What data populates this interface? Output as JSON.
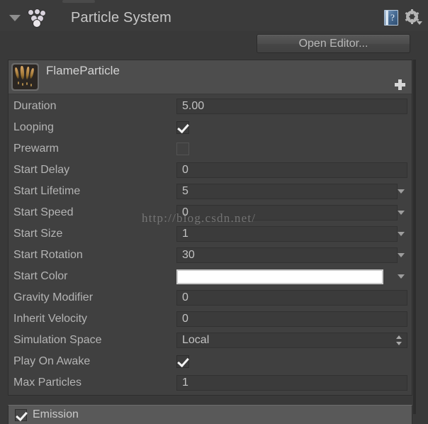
{
  "header": {
    "title": "Particle System",
    "foldout_icon": "triangle-down-icon",
    "component_icon": "particle-system-icon",
    "help_icon": "help-book-icon",
    "help_glyph": "?",
    "settings_icon": "gear-icon"
  },
  "toolbar": {
    "open_editor_label": "Open Editor..."
  },
  "emitter": {
    "name": "FlameParticle",
    "thumbnail_icon": "flame-particle-thumbnail",
    "add_icon": "plus-icon"
  },
  "properties": [
    {
      "label": "Duration",
      "type": "text",
      "value": "5.00",
      "dropdown": false
    },
    {
      "label": "Looping",
      "type": "checkbox",
      "checked": true
    },
    {
      "label": "Prewarm",
      "type": "checkbox",
      "checked": false
    },
    {
      "label": "Start Delay",
      "type": "text",
      "value": "0",
      "dropdown": false
    },
    {
      "label": "Start Lifetime",
      "type": "text",
      "value": "5",
      "dropdown": true
    },
    {
      "label": "Start Speed",
      "type": "text",
      "value": "0",
      "dropdown": true
    },
    {
      "label": "Start Size",
      "type": "text",
      "value": "1",
      "dropdown": true
    },
    {
      "label": "Start Rotation",
      "type": "text",
      "value": "30",
      "dropdown": true
    },
    {
      "label": "Start Color",
      "type": "color",
      "value": "#ffffff",
      "dropdown": true
    },
    {
      "label": "Gravity Modifier",
      "type": "text",
      "value": "0",
      "dropdown": false
    },
    {
      "label": "Inherit Velocity",
      "type": "text",
      "value": "0",
      "dropdown": false
    },
    {
      "label": "Simulation Space",
      "type": "popup",
      "value": "Local"
    },
    {
      "label": "Play On Awake",
      "type": "checkbox",
      "checked": true
    },
    {
      "label": "Max Particles",
      "type": "text",
      "value": "1",
      "dropdown": false
    }
  ],
  "modules": [
    {
      "label": "Emission",
      "enabled": true
    }
  ],
  "watermark": {
    "text": "http://blog.csdn.net/"
  },
  "colors": {
    "panel_bg": "#404040",
    "window_bg": "#393939",
    "field_bg": "#3b3b3b",
    "label_text": "#b4b4b4",
    "value_text": "#c3c3c3",
    "module_header_bg": "#595959",
    "start_color_swatch": "#ffffff"
  }
}
